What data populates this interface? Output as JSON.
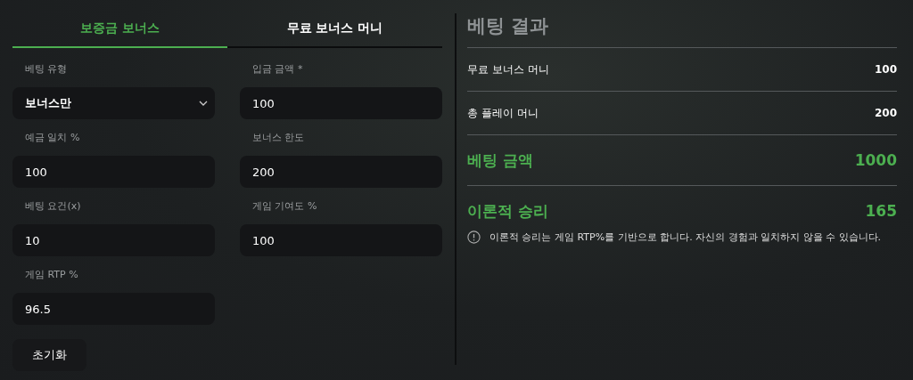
{
  "tabs": [
    {
      "label": "보증금 보너스",
      "selected": true
    },
    {
      "label": "무료 보너스 머니",
      "selected": false
    }
  ],
  "fields": [
    {
      "kind": "select",
      "label": "베팅 유형",
      "value": "보너스만"
    },
    {
      "kind": "input",
      "label": "입금 금액 *",
      "value": "100"
    },
    {
      "kind": "input",
      "label": "예금 일치 %",
      "value": "100"
    },
    {
      "kind": "input",
      "label": "보너스 한도",
      "value": "200"
    },
    {
      "kind": "input",
      "label": "베팅 요건(x)",
      "value": "10"
    },
    {
      "kind": "input",
      "label": "게임 기여도 %",
      "value": "100"
    },
    {
      "kind": "input",
      "label": "게임 RTP %",
      "value": "96.5"
    }
  ],
  "reset_button": "초기화",
  "results": {
    "title": "베팅 결과",
    "rows": [
      {
        "kind": "normal",
        "label": "무료 보너스 머니",
        "value": "100"
      },
      {
        "kind": "normal",
        "label": "총 플레이 머니",
        "value": "200"
      },
      {
        "kind": "highlight",
        "label": "베팅 금액",
        "value": "1000"
      },
      {
        "kind": "highlight",
        "label": "이론적 승리",
        "value": "165"
      }
    ],
    "note": "이론적 승리는 게임 RTP%를 기반으로 합니다. 자신의 경험과 일치하지 않을 수 있습니다."
  }
}
